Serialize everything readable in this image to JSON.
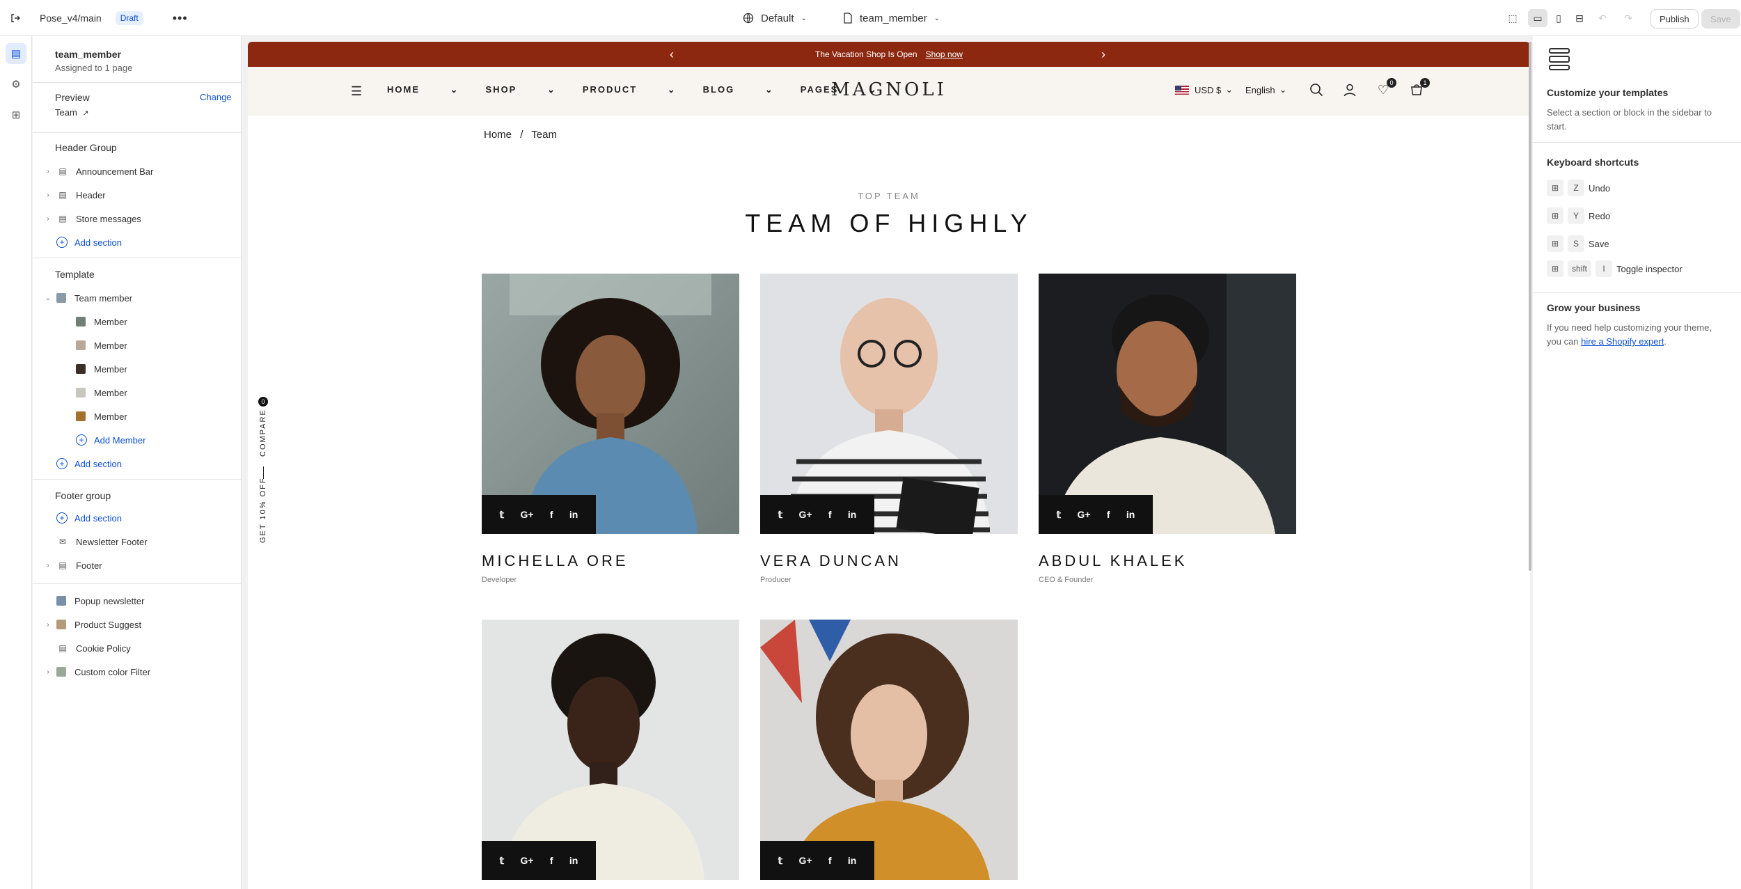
{
  "topbar": {
    "project": "Pose_v4/main",
    "status": "Draft",
    "more": "•••",
    "theme_selector": "Default",
    "template_selector": "team_member",
    "publish_label": "Publish",
    "save_label": "Save"
  },
  "sidebar": {
    "template_name": "team_member",
    "assigned": "Assigned to 1 page",
    "preview_label": "Preview",
    "preview_change": "Change",
    "preview_value": "Team",
    "header_group": {
      "title": "Header Group",
      "items": [
        "Announcement Bar",
        "Header",
        "Store messages"
      ],
      "add_section": "Add section"
    },
    "template": {
      "title": "Template",
      "root": "Team member",
      "members": [
        "Member",
        "Member",
        "Member",
        "Member",
        "Member"
      ],
      "add_member": "Add Member",
      "add_section": "Add section"
    },
    "footer_group": {
      "title": "Footer group",
      "add_section": "Add section",
      "items": [
        "Newsletter Footer",
        "Footer"
      ]
    },
    "extras": [
      "Popup newsletter",
      "Product Suggest",
      "Cookie Policy",
      "Custom color Filter"
    ]
  },
  "store": {
    "announcement": "The Vacation Shop Is Open",
    "announcement_link": "Shop now",
    "nav": [
      "HOME",
      "SHOP",
      "PRODUCT",
      "BLOG",
      "PAGES"
    ],
    "logo": "MAGNOLI",
    "currency": "USD $",
    "language": "English",
    "wishlist_count": "0",
    "cart_count": "1",
    "breadcrumb_home": "Home",
    "breadcrumb_sep": "/",
    "breadcrumb_current": "Team",
    "section_subtitle": "TOP TEAM",
    "section_title": "TEAM OF HIGHLY",
    "compare_label": "COMPARE",
    "discount_label": "GET 10% OFF",
    "members": [
      {
        "name": "MICHELLA ORE",
        "role": "Developer"
      },
      {
        "name": "VERA DUNCAN",
        "role": "Producer"
      },
      {
        "name": "ABDUL KHALEK",
        "role": "CEO & Founder"
      },
      {
        "name": "",
        "role": ""
      },
      {
        "name": "",
        "role": ""
      }
    ],
    "social_icons": [
      "twitter-icon",
      "google-plus-icon",
      "facebook-icon",
      "linkedin-icon"
    ]
  },
  "right_panel": {
    "customize_title": "Customize your templates",
    "customize_text": "Select a section or block in the sidebar to start.",
    "shortcuts_title": "Keyboard shortcuts",
    "shortcuts": [
      {
        "keys": [
          "⊞",
          "Z"
        ],
        "label": "Undo"
      },
      {
        "keys": [
          "⊞",
          "Y"
        ],
        "label": "Redo"
      },
      {
        "keys": [
          "⊞",
          "S"
        ],
        "label": "Save"
      },
      {
        "keys": [
          "⊞",
          "shift",
          "I"
        ],
        "label": "Toggle inspector"
      }
    ],
    "grow_title": "Grow your business",
    "grow_text": "If you need help customizing your theme, you can",
    "grow_link": "hire a Shopify expert",
    "grow_end": "."
  },
  "colors": {
    "announcement_bg": "#8c2810",
    "header_bg": "#f8f5f0",
    "accent_blue": "#0b4fd6"
  }
}
